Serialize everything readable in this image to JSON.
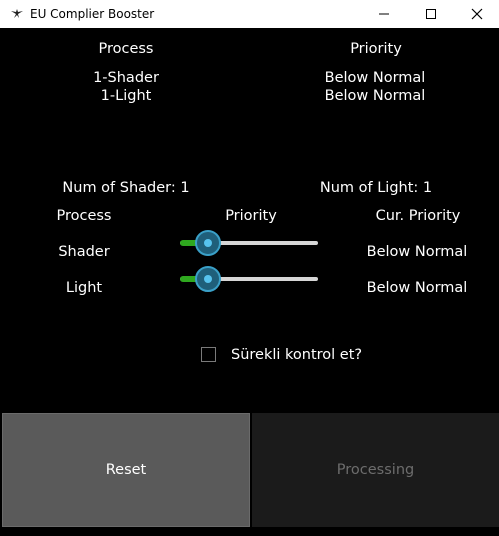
{
  "window": {
    "title": "EU Complier Booster",
    "icon": "app-bird-icon"
  },
  "top_table": {
    "headers": {
      "process": "Process",
      "priority": "Priority"
    },
    "rows": [
      {
        "process": "1-Shader",
        "priority": "Below Normal"
      },
      {
        "process": "1-Light",
        "priority": "Below Normal"
      }
    ]
  },
  "counts": {
    "shader": "Num of Shader: 1",
    "light": "Num of Light: 1"
  },
  "controls_table": {
    "headers": {
      "process": "Process",
      "priority": "Priority",
      "current": "Cur. Priority"
    },
    "rows": [
      {
        "process": "Shader",
        "slider_value": 0.2,
        "current": "Below Normal"
      },
      {
        "process": "Light",
        "slider_value": 0.2,
        "current": "Below Normal"
      }
    ]
  },
  "checkbox": {
    "label": "Sürekli kontrol et?",
    "checked": false
  },
  "buttons": {
    "reset": "Reset",
    "processing": "Processing"
  },
  "colors": {
    "slider_fill": "#2fa81f",
    "slider_knob": "#3aa0c8",
    "reset_bg": "#5a5a5a",
    "processing_bg": "#1b1b1b"
  }
}
